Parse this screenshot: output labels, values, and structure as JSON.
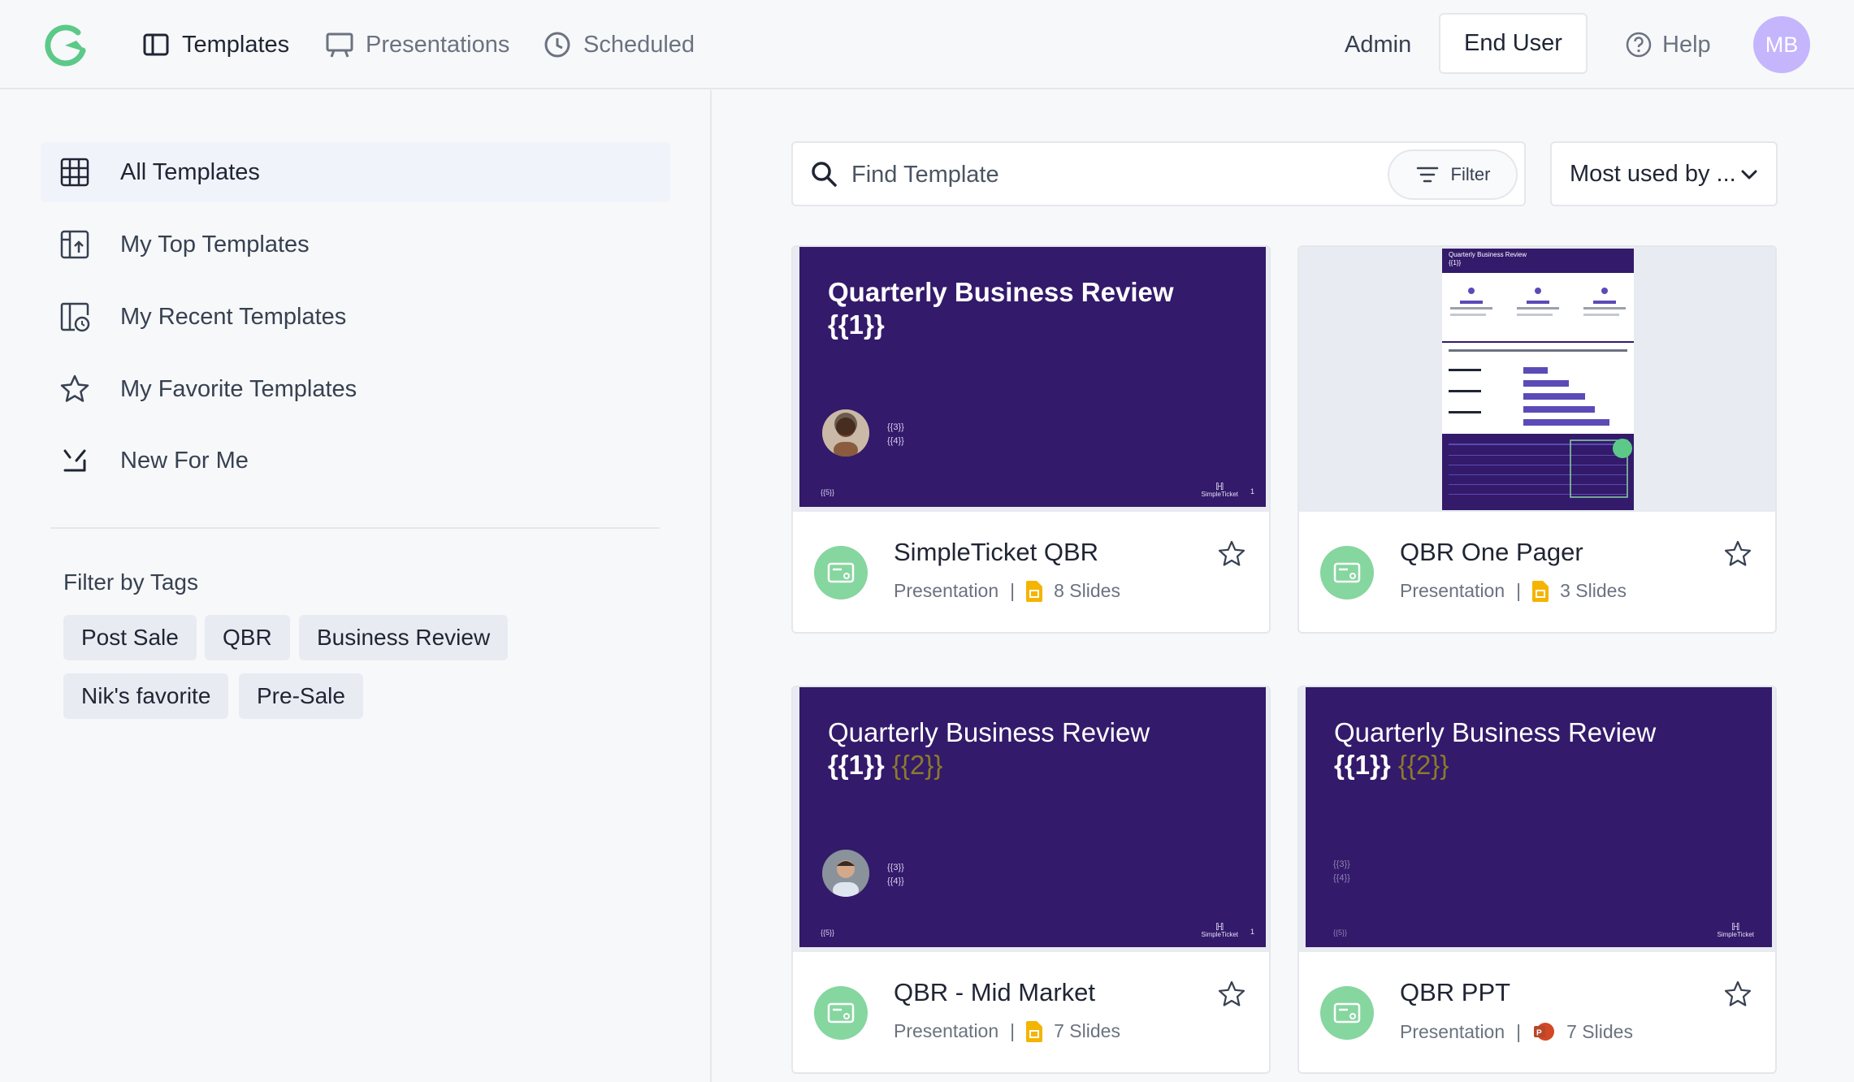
{
  "nav": {
    "templates": "Templates",
    "presentations": "Presentations",
    "scheduled": "Scheduled"
  },
  "header": {
    "admin": "Admin",
    "end_user": "End User",
    "help": "Help",
    "avatar_initials": "MB"
  },
  "sidebar": {
    "items": [
      {
        "label": "All Templates",
        "icon": "grid-icon"
      },
      {
        "label": "My Top Templates",
        "icon": "top-templates-icon"
      },
      {
        "label": "My Recent Templates",
        "icon": "recent-templates-icon"
      },
      {
        "label": "My Favorite Templates",
        "icon": "star-icon"
      },
      {
        "label": "New For Me",
        "icon": "new-icon"
      }
    ],
    "filter_title": "Filter by Tags",
    "tags": [
      "Post Sale",
      "QBR",
      "Business Review",
      "Nik's favorite",
      "Pre-Sale"
    ]
  },
  "search": {
    "placeholder": "Find Template",
    "filter_label": "Filter"
  },
  "sort": {
    "selected": "Most used by ..."
  },
  "cards": [
    {
      "title": "SimpleTicket QBR",
      "type": "Presentation",
      "separator": "|",
      "slides": "8 Slides",
      "file_type": "google-slides",
      "slide_title_line1": "Quarterly Business Review",
      "slide_title_line2": "{{1}}",
      "slide_sub1": "{{3}}",
      "slide_sub2": "{{4}}",
      "slide_foot": "{{5}}",
      "slide_page": "1",
      "slide_brand": "SimpleTicket"
    },
    {
      "title": "QBR One Pager",
      "type": "Presentation",
      "separator": "|",
      "slides": "3 Slides",
      "file_type": "google-slides",
      "slide_title_line1": "Quarterly Business Review",
      "slide_title_line2": "{{1}}"
    },
    {
      "title": "QBR - Mid Market",
      "type": "Presentation",
      "separator": "|",
      "slides": "7 Slides",
      "file_type": "google-slides",
      "slide_title_line1": "Quarterly Business Review",
      "slide_title_line2": "{{1}}",
      "slide_title_muted": "{{2}}",
      "slide_sub1": "{{3}}",
      "slide_sub2": "{{4}}",
      "slide_foot": "{{5}}",
      "slide_page": "1",
      "slide_brand": "SimpleTicket"
    },
    {
      "title": "QBR PPT",
      "type": "Presentation",
      "separator": "|",
      "slides": "7 Slides",
      "file_type": "powerpoint",
      "slide_title_line1": "Quarterly Business  Review",
      "slide_title_line2": "{{1}}",
      "slide_title_muted": "{{2}}",
      "slide_sub1": "{{3}}",
      "slide_sub2": "{{4}}",
      "slide_foot": "{{5}}",
      "slide_brand": "SimpleTicket"
    }
  ],
  "colors": {
    "accent_green": "#86d69f",
    "slide_purple": "#331a6b",
    "avatar_purple": "#c4b5fd"
  }
}
